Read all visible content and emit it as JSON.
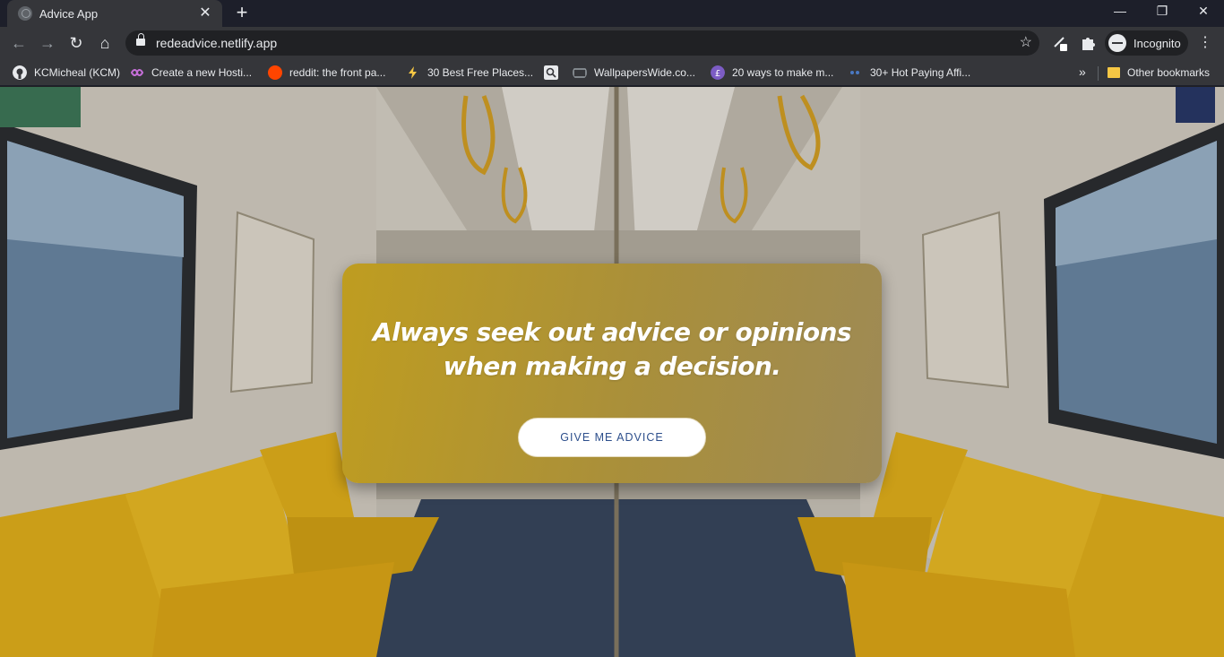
{
  "browser": {
    "tab": {
      "title": "Advice App",
      "favicon": "globe-icon"
    },
    "url": "redeadvice.netlify.app",
    "profile_label": "Incognito",
    "bookmarks": [
      {
        "label": "KCMicheal (KCM)",
        "icon": "github-icon",
        "color": "#e8eaed"
      },
      {
        "label": "Create a new Hosti...",
        "icon": "infinity-icon",
        "color": "#c56fd8"
      },
      {
        "label": "reddit: the front pa...",
        "icon": "reddit-icon",
        "color": "#ff4500"
      },
      {
        "label": "30 Best Free Places...",
        "icon": "bolt-icon",
        "color": "#f6c744"
      },
      {
        "label": "WallpapersWide.co...",
        "icon": "wallpaper-icon",
        "color": "#9aa0a6"
      },
      {
        "label": "20 ways to make m...",
        "icon": "pound-icon",
        "color": "#7c5cc4"
      },
      {
        "label": "30+ Hot Paying Affi...",
        "icon": "dots-icon",
        "color": "#4a78c2"
      }
    ],
    "other_bookmarks": "Other bookmarks",
    "search_bookmark_icon": "search-icon"
  },
  "page": {
    "advice_text": "Always seek out advice or opinions when making a decision.",
    "button_label": "GIVE ME ADVICE",
    "colors": {
      "card": "#b09530",
      "button_text": "#2d4f8c",
      "seat": "#e8b41c"
    }
  }
}
